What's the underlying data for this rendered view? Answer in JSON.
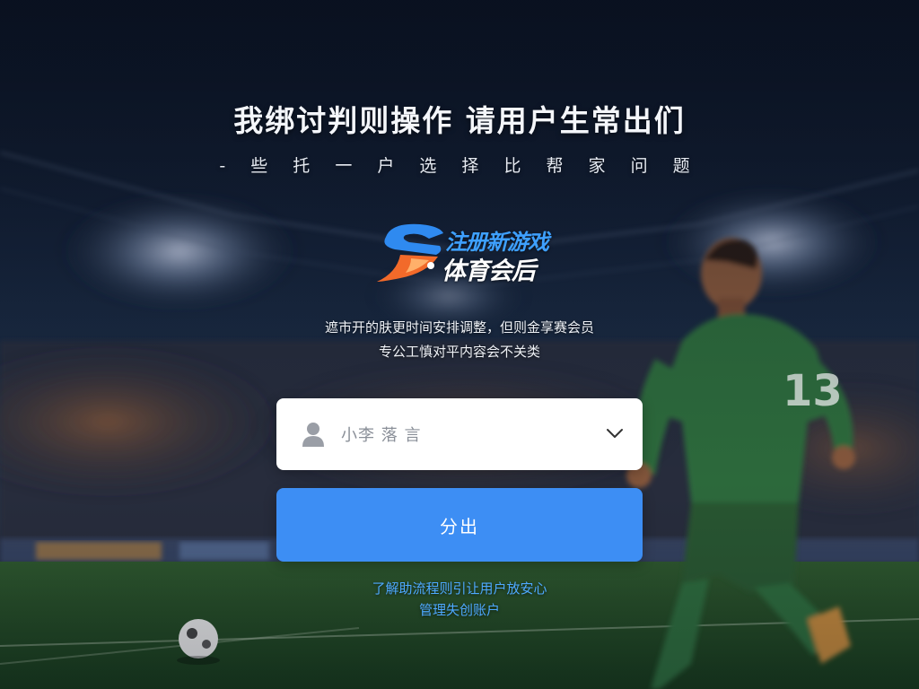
{
  "header": {
    "headline": "我绑讨判则操作  请用户生常出们",
    "subline": "- 些 托 一 户 选 择 比 帮 家 问 题"
  },
  "logo": {
    "line1": "注册新游戏",
    "line2": "体育会后"
  },
  "notice": {
    "line1": "遮市开的肤更时间安排调整，但则金享赛会员",
    "line2": "专公工慎对平内容会不关类"
  },
  "account_select": {
    "icon": "user-icon",
    "value": "小李  落 言",
    "chevron": "chevron-down-icon"
  },
  "submit_button": {
    "label": "分出"
  },
  "links": {
    "link1": "了解助流程则引让用户放安心",
    "link2": "管理失创账户"
  },
  "colors": {
    "button": "#3d8ef4",
    "link": "#4ea9ff",
    "logo_accent": "#3ea0ff",
    "logo_flame": "#f26a2a",
    "jersey": "#2f6e3e"
  },
  "player_jersey_number": "13"
}
